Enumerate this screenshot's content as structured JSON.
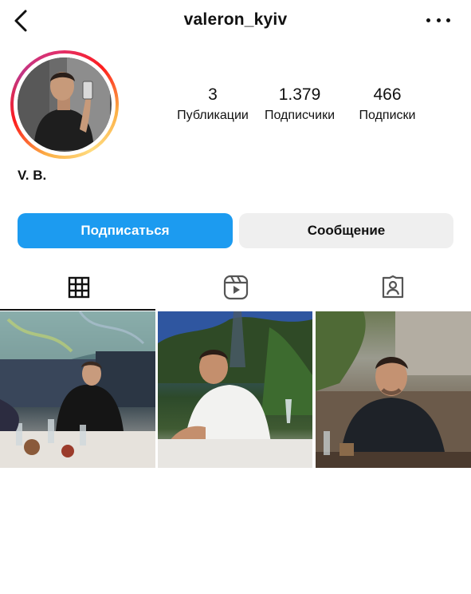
{
  "header": {
    "username": "valeron_kyiv",
    "back_icon": "chevron-left-icon",
    "more_icon": "more-horizontal-icon"
  },
  "profile": {
    "full_name": "V. B.",
    "story_ring_colors": [
      "#fcaf45",
      "#fd1d1d",
      "#e1306c",
      "#c13584"
    ],
    "stats": [
      {
        "value": "3",
        "label": "Публикации"
      },
      {
        "value": "1.379",
        "label": "Подписчики"
      },
      {
        "value": "466",
        "label": "Подписки"
      }
    ]
  },
  "actions": {
    "follow_label": "Подписаться",
    "message_label": "Сообщение",
    "follow_color": "#1c9bf0"
  },
  "tabs": [
    {
      "icon": "grid-icon",
      "active": true
    },
    {
      "icon": "reels-icon",
      "active": false
    },
    {
      "icon": "tagged-icon",
      "active": false
    }
  ]
}
